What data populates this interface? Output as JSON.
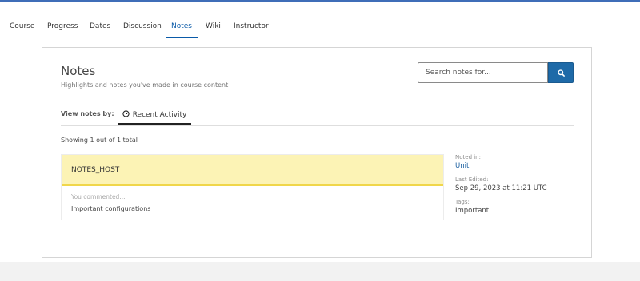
{
  "nav": {
    "tabs": [
      {
        "label": "Course"
      },
      {
        "label": "Progress"
      },
      {
        "label": "Dates"
      },
      {
        "label": "Discussion"
      },
      {
        "label": "Notes",
        "active": true
      },
      {
        "label": "Wiki"
      },
      {
        "label": "Instructor"
      }
    ]
  },
  "notes_page": {
    "title": "Notes",
    "subtitle": "Highlights and notes you've made in course content",
    "search": {
      "placeholder": "Search notes for...",
      "value": "",
      "button_icon": "search-icon"
    },
    "view_by": {
      "label": "View notes by:",
      "tab_label": "Recent Activity",
      "tab_icon": "clock-icon"
    },
    "showing": "Showing 1 out of 1 total",
    "notes": [
      {
        "highlight": "NOTES_HOST",
        "comment_label": "You commented...",
        "comment": "Important configurations",
        "noted_in_label": "Noted in:",
        "noted_in": "Unit",
        "last_edited_label": "Last Edited:",
        "last_edited": "Sep 29, 2023 at 11:21 UTC",
        "tags_label": "Tags:",
        "tags": "Important"
      }
    ]
  },
  "colors": {
    "accent": "#0a5aa8",
    "search_button": "#1e6aa8",
    "highlight_bg": "#fcf3b5",
    "highlight_border": "#f0d64a",
    "top_bar": "#3f6db8"
  }
}
